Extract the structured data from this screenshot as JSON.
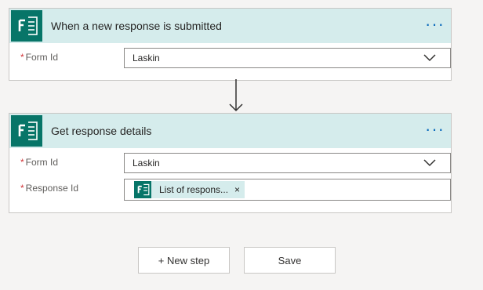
{
  "trigger": {
    "title": "When a new response is submitted",
    "more": "···",
    "fields": [
      {
        "required_mark": "*",
        "label": "Form Id",
        "value": "Laskin"
      }
    ]
  },
  "action": {
    "title": "Get response details",
    "more": "···",
    "fields": [
      {
        "required_mark": "*",
        "label": "Form Id",
        "value": "Laskin"
      },
      {
        "required_mark": "*",
        "label": "Response Id",
        "token_label": "List of respons...",
        "token_close": "×"
      }
    ]
  },
  "buttons": {
    "new_step": "+ New step",
    "save": "Save"
  },
  "colors": {
    "header_bg": "#d5ecec",
    "forms_green": "#077568",
    "more_blue": "#0f6cbd",
    "required_red": "#d13438"
  },
  "icons": {
    "app": "microsoft-forms-icon",
    "dropdown": "chevron-down-icon",
    "connector": "arrow-down-icon"
  }
}
